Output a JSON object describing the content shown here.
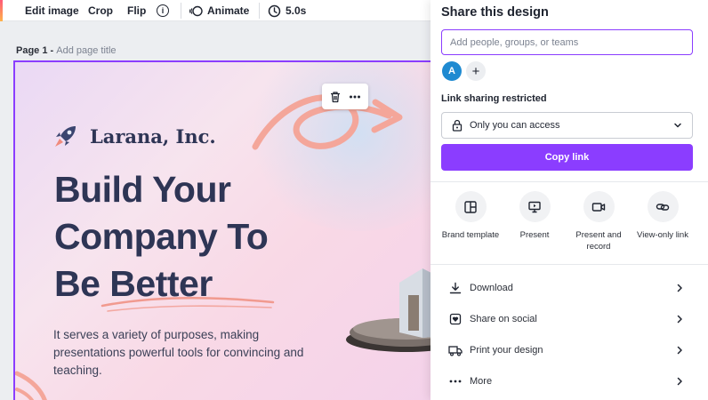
{
  "toolbar": {
    "edit_image": "Edit image",
    "crop": "Crop",
    "flip": "Flip",
    "info_glyph": "i",
    "animate": "Animate",
    "duration": "5.0s"
  },
  "page": {
    "label": "Page 1 -",
    "title_placeholder": "Add page title"
  },
  "canvas": {
    "brand_name": "Larana, Inc.",
    "headline": [
      "Build Your",
      "Company To",
      "Be Better"
    ],
    "body": "It serves a variety of purposes, making presentations powerful tools for convincing and teaching."
  },
  "share": {
    "title": "Share this design",
    "input_placeholder": "Add people, groups, or teams",
    "avatar_initial": "A",
    "add_glyph": "+",
    "link_label": "Link sharing restricted",
    "access_value": "Only you can access",
    "copy_link": "Copy link",
    "options": [
      {
        "label": "Brand template",
        "icon": "brand-template-icon"
      },
      {
        "label": "Present",
        "icon": "present-icon"
      },
      {
        "label": "Present and record",
        "icon": "record-icon"
      },
      {
        "label": "View-only link",
        "icon": "link-icon"
      }
    ],
    "rows": [
      {
        "label": "Download",
        "icon": "download-icon"
      },
      {
        "label": "Share on social",
        "icon": "heart-icon"
      },
      {
        "label": "Print your design",
        "icon": "truck-icon"
      },
      {
        "label": "More",
        "icon": "more-icon"
      }
    ]
  },
  "colors": {
    "accent": "#8b3dff",
    "headline": "#2e3555",
    "avatar": "#1f8ad1",
    "brush_stroke": "#f4a69a"
  }
}
